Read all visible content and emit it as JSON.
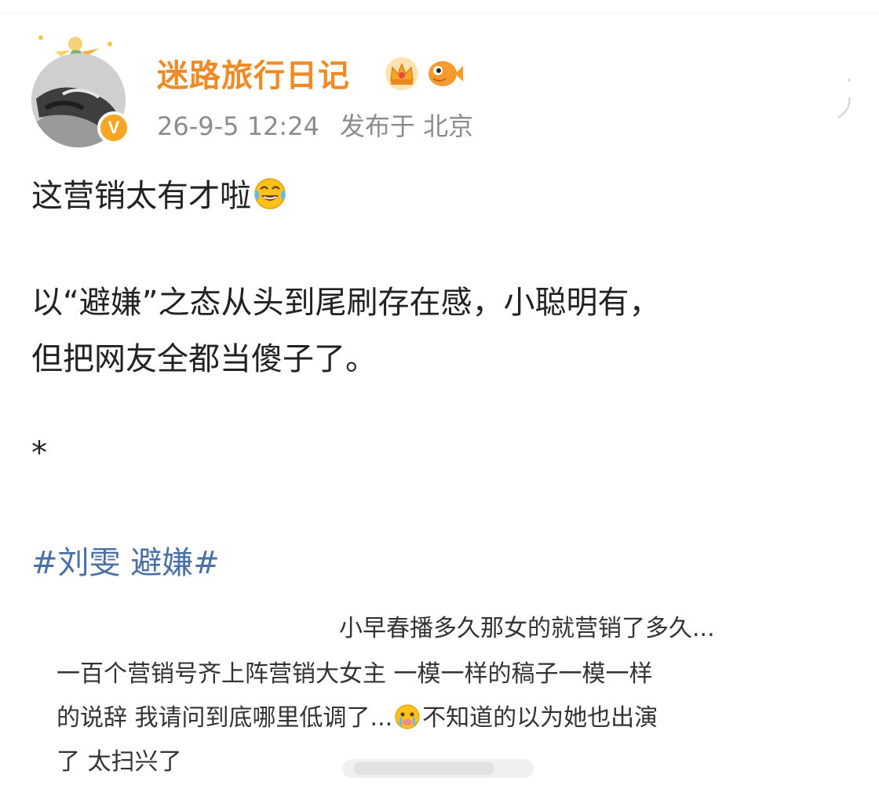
{
  "post": {
    "author": "迷路旅行日记",
    "verified_badge": "V",
    "timestamp": "26-9-5 12:24",
    "location": "发布于 北京",
    "lines": [
      "这营销太有才啦",
      "以“避嫌”之态从头到尾刷存在感，小聪明有，",
      "但把网友全都当傻子了。",
      "*"
    ],
    "hashtag": "#刘雯 避嫌#"
  },
  "quote": {
    "line1": "小早春播多久那女的就营销了多久...",
    "line2": "一百个营销号齐上阵营销大女主 一模一样的稿子一模一样",
    "line3_a": "的说辞 我请问到底哪里低调了...",
    "line3_b": "不知道的以为她也出演",
    "line4": "了 太扫兴了"
  },
  "icons": {
    "badge": "crown-icon",
    "fan": "fish-icon",
    "emoji1": "laughing-tears-icon",
    "emoji2": "crying-face-icon"
  },
  "colors": {
    "author": "#f08a24",
    "meta": "#8c8c8c",
    "hashtag": "#4a6fa5",
    "body": "#222222",
    "verified": "#f5a623"
  }
}
